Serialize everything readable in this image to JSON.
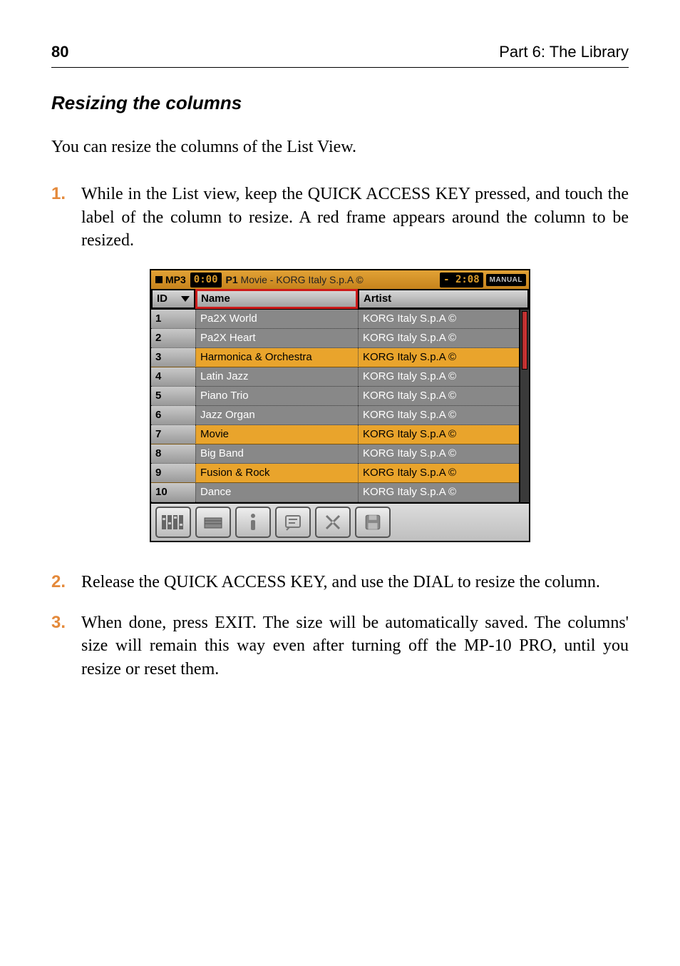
{
  "header": {
    "page": "80",
    "section": "Part 6: The Library"
  },
  "heading": "Resizing the columns",
  "intro": "You can resize the columns of the List View.",
  "steps": [
    "While in the List view, keep the QUICK ACCESS KEY pressed, and touch the label of the column to resize. A red frame appears around the column to be resized.",
    "Release the QUICK ACCESS KEY, and use the DIAL to resize the column.",
    "When done, press EXIT. The size will be automatically saved. The columns' size will remain this way even after turning off the MP-10 PRO, until you resize or reset them."
  ],
  "screenshot": {
    "title": {
      "tag": "MP3",
      "time_elapsed": "0:00",
      "prefix": "P1",
      "song": "Movie - KORG Italy S.p.A ©",
      "time_remain": "- 2:08",
      "mode": "MANUAL"
    },
    "columns": {
      "id": "ID",
      "name": "Name",
      "artist": "Artist"
    },
    "rows": [
      {
        "id": "1",
        "name": "Pa2X World",
        "artist": "KORG Italy S.p.A ©"
      },
      {
        "id": "2",
        "name": "Pa2X Heart",
        "artist": "KORG Italy S.p.A ©"
      },
      {
        "id": "3",
        "name": "Harmonica & Orchestra",
        "artist": "KORG Italy S.p.A ©"
      },
      {
        "id": "4",
        "name": "Latin Jazz",
        "artist": "KORG Italy S.p.A ©"
      },
      {
        "id": "5",
        "name": "Piano Trio",
        "artist": "KORG Italy S.p.A ©"
      },
      {
        "id": "6",
        "name": "Jazz Organ",
        "artist": "KORG Italy S.p.A ©"
      },
      {
        "id": "7",
        "name": "Movie",
        "artist": "KORG Italy S.p.A ©"
      },
      {
        "id": "8",
        "name": "Big Band",
        "artist": "KORG Italy S.p.A ©"
      },
      {
        "id": "9",
        "name": "Fusion & Rock",
        "artist": "KORG Italy S.p.A ©"
      },
      {
        "id": "10",
        "name": "Dance",
        "artist": "KORG Italy S.p.A ©"
      }
    ],
    "selected_row": 6,
    "resize_rows": [
      2,
      8
    ],
    "toolbar_icons": [
      "mixer-icon",
      "keyboard-icon",
      "info-icon",
      "lyrics-icon",
      "tools-icon",
      "save-icon"
    ]
  }
}
